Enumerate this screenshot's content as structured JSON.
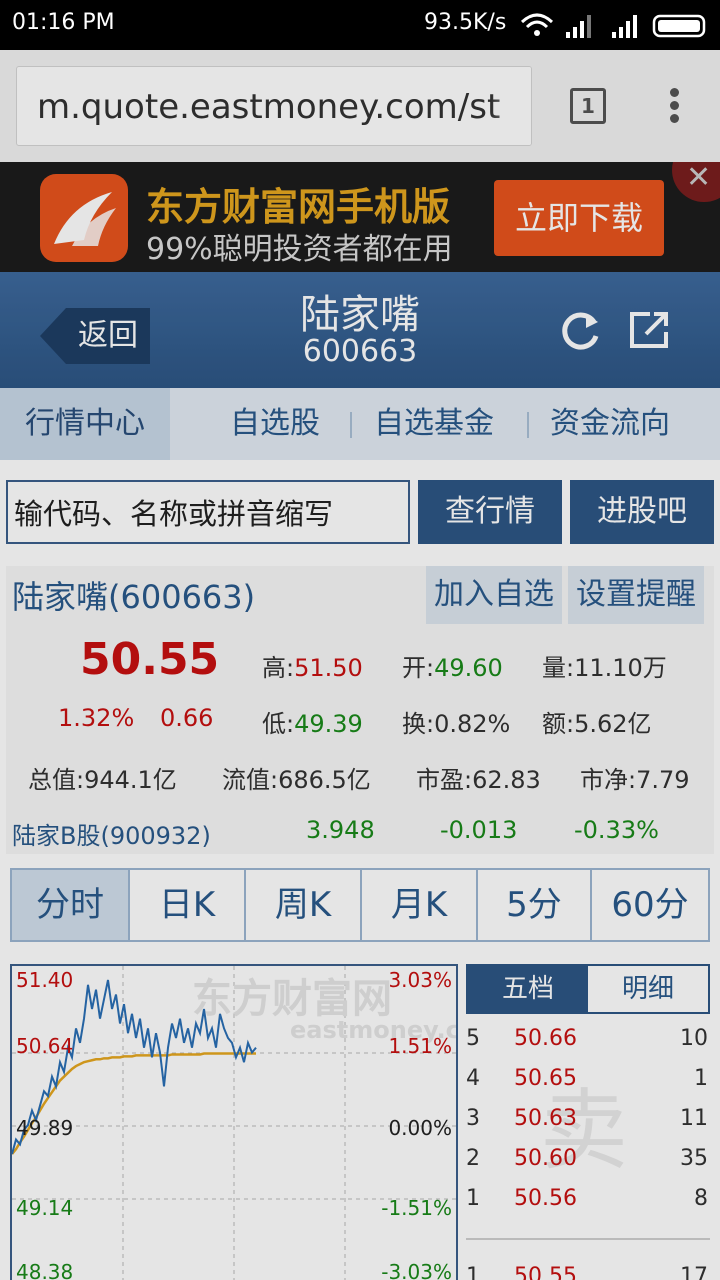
{
  "status_bar": {
    "time": "01:16 PM",
    "net_speed": "93.5K/s"
  },
  "browser": {
    "url": "m.quote.eastmoney.com/st",
    "tab_count": "1"
  },
  "ad": {
    "title": "东方财富网手机版",
    "subtitle": "99%聪明投资者都在用",
    "button": "立即下载"
  },
  "header": {
    "back": "返回",
    "name": "陆家嘴",
    "code": "600663"
  },
  "nav": {
    "items": [
      "行情中心",
      "自选股",
      "自选基金",
      "资金流向"
    ]
  },
  "search": {
    "placeholder": "输代码、名称或拼音缩写",
    "quote_button": "查行情",
    "forum_button": "进股吧"
  },
  "quote": {
    "title": "陆家嘴(600663)",
    "add_watch": "加入自选",
    "set_alert": "设置提醒",
    "price": "50.55",
    "change_pct": "1.32%",
    "change": "0.66",
    "high_label": "高:",
    "high": "51.50",
    "open_label": "开:",
    "open": "49.60",
    "volume": "量:11.10万",
    "low_label": "低:",
    "low": "49.39",
    "turnover": "换:0.82%",
    "amount": "额:5.62亿",
    "total_value": "总值:944.1亿",
    "float_value": "流值:686.5亿",
    "pe": "市盈:62.83",
    "pb": "市净:7.79",
    "b_share": {
      "name": "陆家B股(900932)",
      "price": "3.948",
      "change": "-0.013",
      "change_pct": "-0.33%"
    }
  },
  "period_tabs": [
    "分时",
    "日K",
    "周K",
    "月K",
    "5分",
    "60分"
  ],
  "chart": {
    "watermark_main": "东方财富网",
    "watermark_sub": "eastmoney.com",
    "left_labels": [
      "51.40",
      "50.64",
      "49.89",
      "49.14",
      "48.38"
    ],
    "right_labels": [
      "3.03%",
      "1.51%",
      "0.00%",
      "-1.51%",
      "-3.03%"
    ],
    "price_series": [
      49.6,
      49.75,
      49.7,
      49.85,
      49.9,
      50.05,
      49.95,
      50.1,
      50.25,
      50.2,
      50.4,
      50.3,
      50.55,
      50.45,
      50.7,
      50.6,
      50.9,
      50.75,
      51.0,
      51.35,
      51.1,
      51.3,
      51.0,
      51.2,
      51.4,
      51.1,
      51.25,
      50.95,
      51.15,
      50.85,
      51.05,
      50.8,
      51.0,
      50.7,
      50.9,
      50.6,
      50.85,
      50.65,
      50.3,
      50.7,
      50.95,
      50.8,
      51.0,
      50.75,
      50.9,
      50.7,
      50.95,
      50.85,
      51.1,
      50.8,
      50.9,
      50.7,
      51.05,
      50.9,
      50.8,
      50.75,
      50.6,
      50.7,
      50.55,
      50.75,
      50.65,
      50.7
    ],
    "avg_series": [
      49.6,
      49.65,
      49.72,
      49.78,
      49.85,
      49.92,
      49.98,
      50.05,
      50.12,
      50.18,
      50.24,
      50.3,
      50.36,
      50.4,
      50.44,
      50.48,
      50.51,
      50.53,
      50.55,
      50.56,
      50.57,
      50.58,
      50.58,
      50.59,
      50.59,
      50.6,
      50.6,
      50.6,
      50.61,
      50.61,
      50.61,
      50.62,
      50.62,
      50.62,
      50.62,
      50.62,
      50.62,
      50.62,
      50.62,
      50.62,
      50.63,
      50.63,
      50.63,
      50.63,
      50.63,
      50.63,
      50.63,
      50.63,
      50.64,
      50.64,
      50.64,
      50.64,
      50.64,
      50.64,
      50.64,
      50.64,
      50.64,
      50.64,
      50.64,
      50.64,
      50.64,
      50.64
    ],
    "ymin": 48.38,
    "ymax": 51.4
  },
  "order_book": {
    "tabs": [
      "五档",
      "明细"
    ],
    "sell_label": "卖",
    "rows": [
      {
        "level": "5",
        "price": "50.66",
        "volume": "10"
      },
      {
        "level": "4",
        "price": "50.65",
        "volume": "1"
      },
      {
        "level": "3",
        "price": "50.63",
        "volume": "11"
      },
      {
        "level": "2",
        "price": "50.60",
        "volume": "35"
      },
      {
        "level": "1",
        "price": "50.56",
        "volume": "8"
      }
    ],
    "buy_row": {
      "level": "1",
      "price": "50.55",
      "volume": "17"
    }
  }
}
